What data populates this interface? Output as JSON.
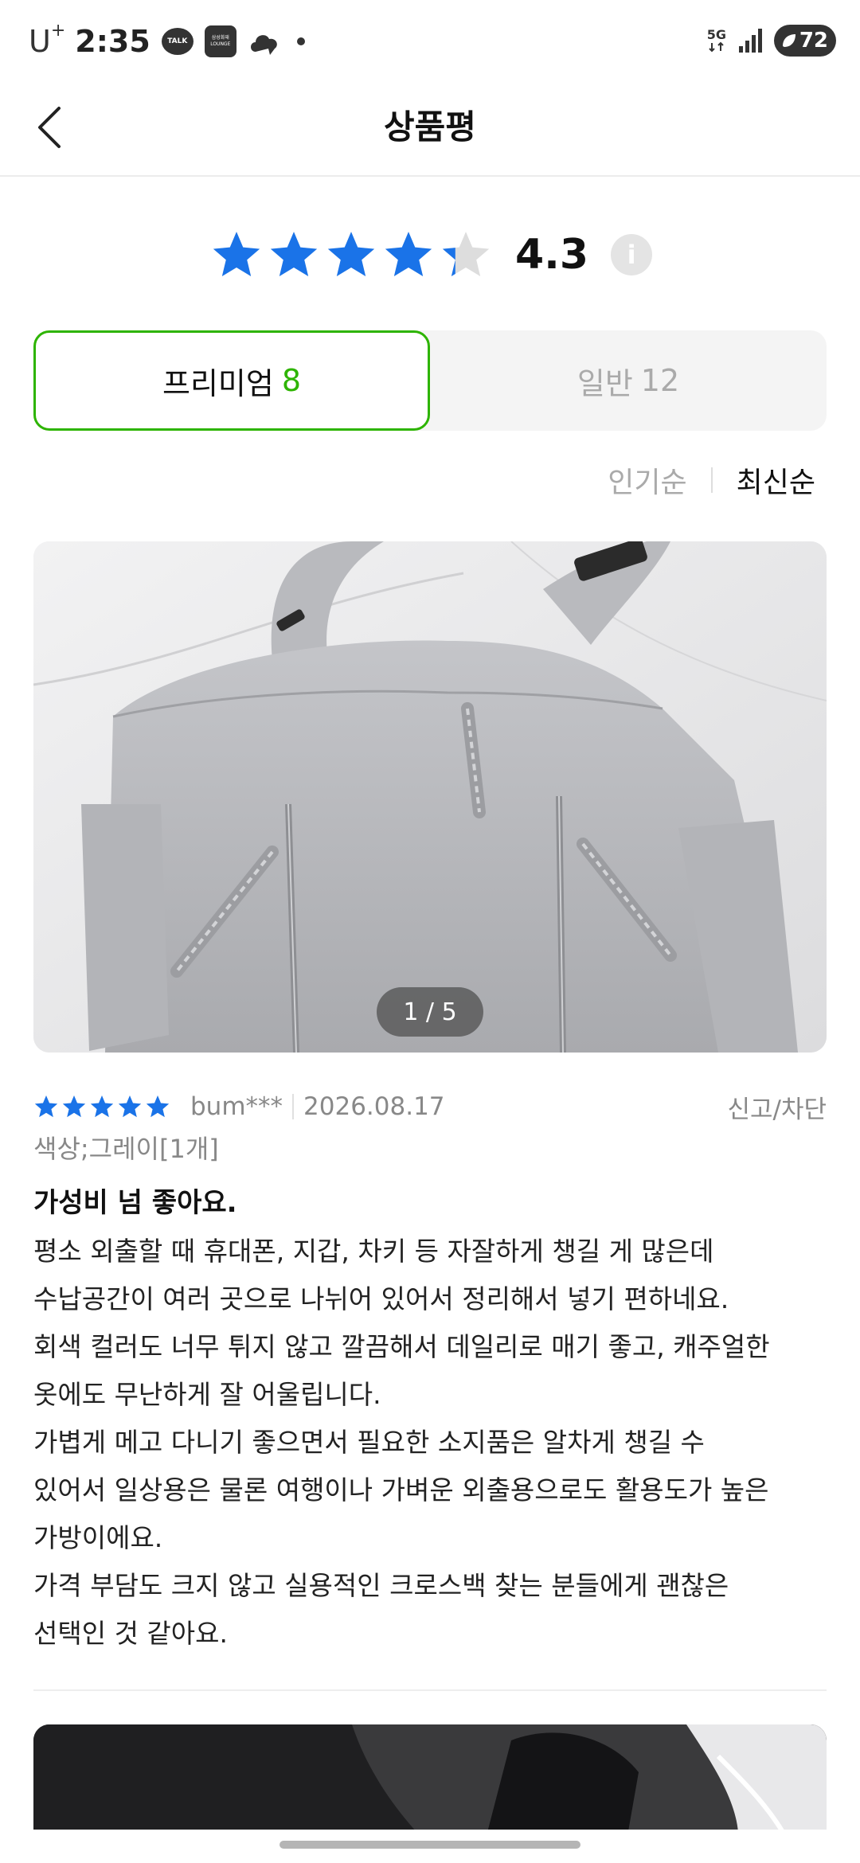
{
  "status_bar": {
    "carrier": "U",
    "carrier_sup": "+",
    "time": "2:35",
    "talk_icon_text": "TALK",
    "lounge_icon_text_1": "삼성화재",
    "lounge_icon_text_2": "LOUNGE",
    "network": "5G",
    "battery": "72"
  },
  "header": {
    "title": "상품평"
  },
  "rating": {
    "value": "4.3",
    "stars_fraction": 0.86,
    "star_color": "#1a73e8"
  },
  "tabs": {
    "premium_label": "프리미엄",
    "premium_count": "8",
    "general_label": "일반",
    "general_count": "12",
    "active_color": "#2db400"
  },
  "sort": {
    "popular": "인기순",
    "latest": "최신순"
  },
  "review": {
    "photo_counter": "1 / 5",
    "stars": 5,
    "reviewer": "bum***",
    "date": "2026.08.17",
    "report": "신고/차단",
    "option": "색상;그레이[1개]",
    "title": "가성비 넘 좋아요.",
    "body_lines": [
      "평소 외출할 때 휴대폰, 지갑, 차키 등 자잘하게 챙길 게 많은데",
      "수납공간이 여러 곳으로 나뉘어 있어서 정리해서 넣기 편하네요.",
      "회색 컬러도 너무 튀지 않고 깔끔해서 데일리로 매기 좋고, 캐주얼한",
      "옷에도 무난하게 잘 어울립니다.",
      "가볍게 메고 다니기 좋으면서 필요한 소지품은 알차게 챙길 수",
      "있어서 일상용은 물론 여행이나 가벼운 외출용으로도 활용도가 높은",
      "가방이에요.",
      "가격 부담도 크지 않고 실용적인 크로스백 찾는 분들에게 괜찮은",
      "선택인 것 같아요."
    ]
  }
}
